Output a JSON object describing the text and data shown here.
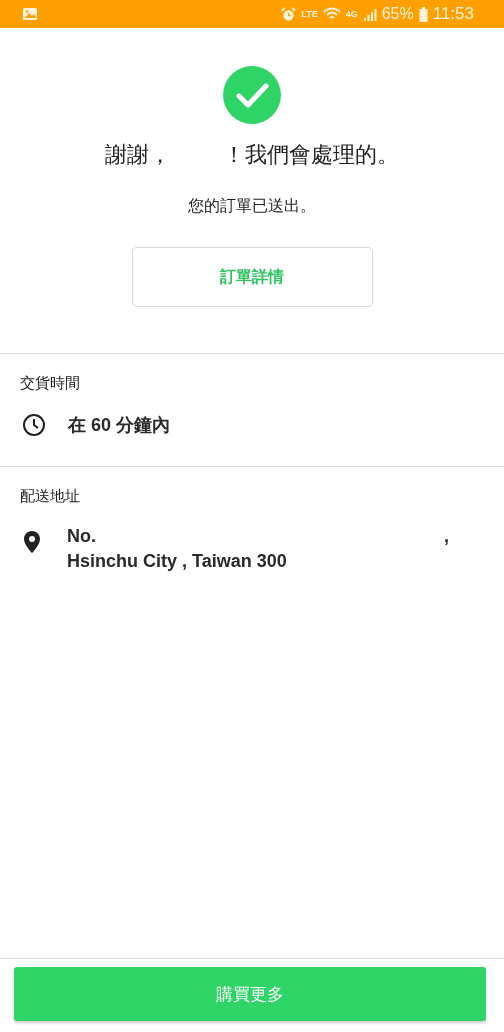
{
  "status_bar": {
    "network": "LTE",
    "mobile_data": "4G",
    "battery": "65%",
    "time": "11:53"
  },
  "confirmation": {
    "heading_start": "謝謝，",
    "heading_end": "！我們會處理的。",
    "message": "您的訂單已送出。",
    "details_button": "訂單詳情"
  },
  "delivery_time": {
    "label": "交貨時間",
    "value": "在 60 分鐘內"
  },
  "delivery_address": {
    "label": "配送地址",
    "line_1": "No.",
    "line_1_end": ",",
    "line_2": "Hsinchu City , Taiwan 300"
  },
  "footer": {
    "button": "購買更多"
  }
}
